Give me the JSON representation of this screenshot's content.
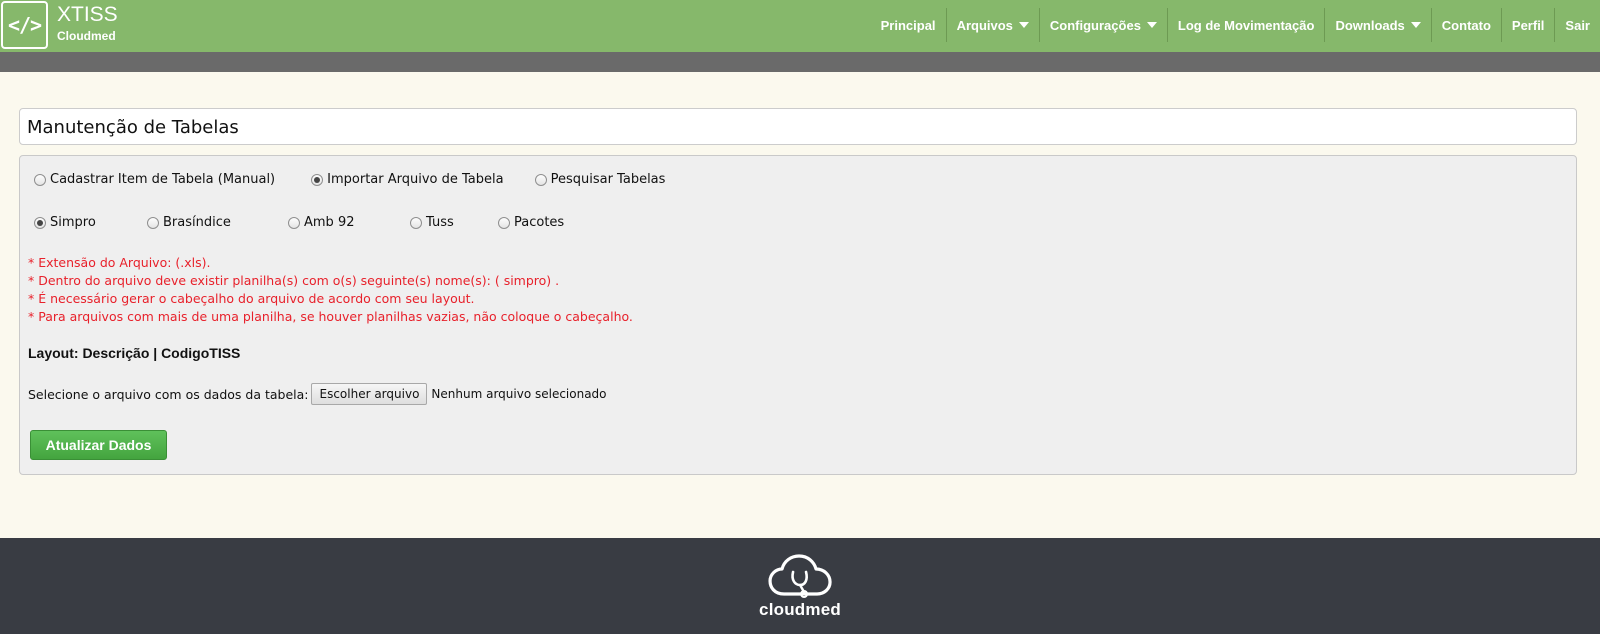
{
  "brand": {
    "logo_glyph": "</>",
    "title": "XTISS",
    "subtitle": "Cloudmed"
  },
  "nav": {
    "items": [
      {
        "label": "Principal",
        "dropdown": false
      },
      {
        "label": "Arquivos",
        "dropdown": true
      },
      {
        "label": "Configurações",
        "dropdown": true
      },
      {
        "label": "Log de Movimentação",
        "dropdown": false
      },
      {
        "label": "Downloads",
        "dropdown": true
      },
      {
        "label": "Contato",
        "dropdown": false
      },
      {
        "label": "Perfil",
        "dropdown": false
      },
      {
        "label": "Sair",
        "dropdown": false
      }
    ]
  },
  "page": {
    "title": "Manutenção de Tabelas"
  },
  "mode_options": [
    {
      "label": "Cadastrar Item de Tabela (Manual)",
      "checked": false
    },
    {
      "label": "Importar Arquivo de Tabela",
      "checked": true
    },
    {
      "label": "Pesquisar Tabelas",
      "checked": false
    }
  ],
  "table_options": [
    {
      "label": "Simpro",
      "checked": true
    },
    {
      "label": "Brasíndice",
      "checked": false
    },
    {
      "label": "Amb 92",
      "checked": false
    },
    {
      "label": "Tuss",
      "checked": false
    },
    {
      "label": "Pacotes",
      "checked": false
    }
  ],
  "warnings": [
    "* Extensão do Arquivo: (.xls).",
    "* Dentro do arquivo deve existir planilha(s) com o(s) seguinte(s) nome(s): ( simpro) .",
    "* É necessário gerar o cabeçalho do arquivo de acordo com seu layout.",
    "* Para arquivos com mais de uma planilha, se houver planilhas vazias, não coloque o cabeçalho."
  ],
  "layout_label": "Layout: Descrição | CodigoTISS",
  "file": {
    "label": "Selecione o arquivo com os dados da tabela:",
    "button": "Escolher arquivo",
    "status": "Nenhum arquivo selecionado"
  },
  "submit_label": "Atualizar Dados",
  "footer": {
    "logo_text": "cloudmed"
  },
  "colors": {
    "navbar": "#86b86b",
    "subbar": "#6a6a6a",
    "warning": "#e8212b",
    "submit": "#4cae47",
    "footer": "#393c43"
  }
}
